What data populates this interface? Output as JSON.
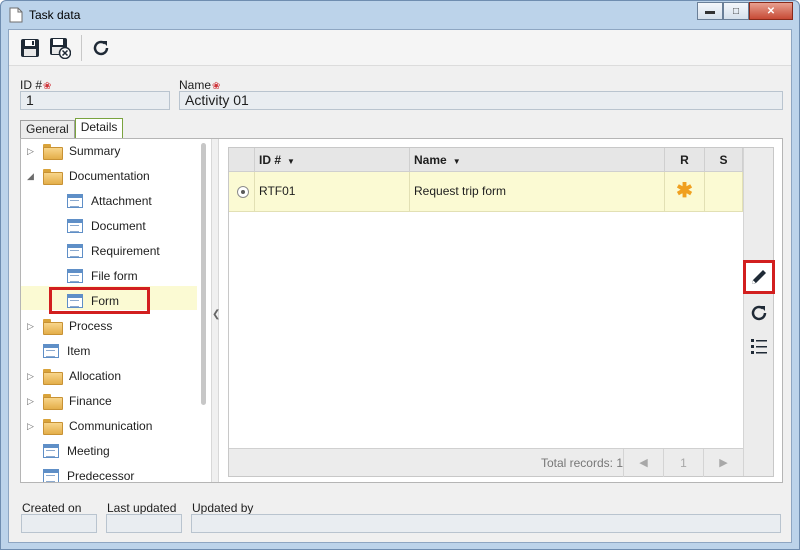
{
  "window": {
    "title": "Task data",
    "minimize": "▬",
    "maximize": "□",
    "close": "✕"
  },
  "toolbar": {
    "save_icon": "save-icon",
    "save_close_icon": "save-close-icon",
    "refresh_icon": "refresh-icon"
  },
  "fields": {
    "id_label": "ID #",
    "id_value": "1",
    "name_label": "Name",
    "name_value": "Activity 01",
    "required_mark": "❀"
  },
  "tabs": [
    {
      "label": "General"
    },
    {
      "label": "Details"
    }
  ],
  "tree": {
    "items": [
      {
        "label": "Summary",
        "type": "folder",
        "level": 0,
        "expander": "▷"
      },
      {
        "label": "Documentation",
        "type": "folder-open",
        "level": 0,
        "expander": "◢"
      },
      {
        "label": "Attachment",
        "type": "form",
        "level": 1
      },
      {
        "label": "Document",
        "type": "form",
        "level": 1
      },
      {
        "label": "Requirement",
        "type": "form",
        "level": 1
      },
      {
        "label": "File form",
        "type": "form",
        "level": 1
      },
      {
        "label": "Form",
        "type": "form",
        "level": 1,
        "selected": true
      },
      {
        "label": "Process",
        "type": "folder",
        "level": 0,
        "expander": "▷"
      },
      {
        "label": "Item",
        "type": "form",
        "level": 0
      },
      {
        "label": "Allocation",
        "type": "folder",
        "level": 0,
        "expander": "▷"
      },
      {
        "label": "Finance",
        "type": "folder",
        "level": 0,
        "expander": "▷"
      },
      {
        "label": "Communication",
        "type": "folder",
        "level": 0,
        "expander": "▷"
      },
      {
        "label": "Meeting",
        "type": "form",
        "level": 0
      },
      {
        "label": "Predecessor",
        "type": "form",
        "level": 0
      }
    ]
  },
  "grid": {
    "columns": [
      {
        "label": "ID #"
      },
      {
        "label": "Name"
      },
      {
        "label": "R"
      },
      {
        "label": "S"
      }
    ],
    "rows": [
      {
        "id": "RTF01",
        "name": "Request trip form",
        "r": "✱",
        "s": ""
      }
    ],
    "total_records": "Total records: 1",
    "pager": {
      "prev": "◀",
      "page": "1",
      "next": "▶"
    },
    "accent_color": "#f0a020"
  },
  "side_actions": {
    "edit_icon": "pencil-icon",
    "refresh_icon": "refresh-icon",
    "list_icon": "list-icon"
  },
  "status": {
    "created_on": "Created on",
    "last_updated": "Last updated",
    "updated_by": "Updated by"
  }
}
